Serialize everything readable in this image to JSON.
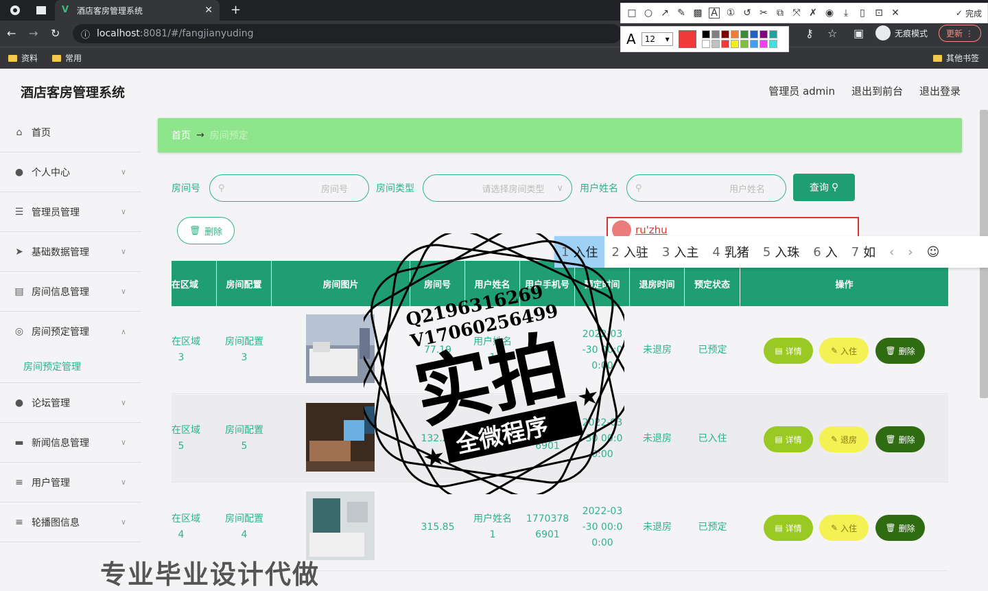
{
  "browser": {
    "tab_title": "酒店客房管理系统",
    "url_host": "localhost",
    "url_path": ":8081/#/fangjianyuding",
    "bookmarks": [
      "资料",
      "常用"
    ],
    "other_bookmarks": "其他书签",
    "incognito_label": "无痕模式",
    "update_label": "更新"
  },
  "annotation_toolbar": {
    "done_label": "完成",
    "font_size": "12",
    "active_color": "#f03a3a",
    "palette": [
      "#000000",
      "#808080",
      "#800000",
      "#f08030",
      "#3a8a3a",
      "#2060c0",
      "#800080",
      "#20a0a0",
      "#ffffff",
      "#c0c0c0",
      "#f03a3a",
      "#f0f020",
      "#80c040",
      "#40a0f0",
      "#f040f0",
      "#40e0e0"
    ]
  },
  "app": {
    "title": "酒店客房管理系统",
    "top_links": [
      "管理员 admin",
      "退出到前台",
      "退出登录"
    ]
  },
  "sidebar": {
    "items": [
      {
        "label": "首页",
        "icon": "home-icon"
      },
      {
        "label": "个人中心",
        "icon": "user-icon"
      },
      {
        "label": "管理员管理",
        "icon": "sliders-icon"
      },
      {
        "label": "基础数据管理",
        "icon": "send-icon"
      },
      {
        "label": "房间信息管理",
        "icon": "clipboard-icon"
      },
      {
        "label": "房间预定管理",
        "icon": "compass-icon"
      },
      {
        "label": "论坛管理",
        "icon": "user-icon"
      },
      {
        "label": "新闻信息管理",
        "icon": "monitor-icon"
      },
      {
        "label": "用户管理",
        "icon": "menu-icon"
      },
      {
        "label": "轮播图信息",
        "icon": "menu-icon"
      }
    ],
    "sub_item": "房间预定管理"
  },
  "breadcrumb": {
    "home": "首页",
    "arrow": "→",
    "current": "房间预定"
  },
  "search": {
    "room_no_label": "房间号",
    "room_no_placeholder": "房间号",
    "room_type_label": "房间类型",
    "room_type_placeholder": "请选择房间类型",
    "user_name_label": "用户姓名",
    "user_name_placeholder": "用户姓名",
    "query_label": "查询"
  },
  "delete_label": "删除",
  "ime": {
    "typed": "ru'zhu",
    "candidates": [
      {
        "n": "1",
        "text": "入住"
      },
      {
        "n": "2",
        "text": "入驻"
      },
      {
        "n": "3",
        "text": "入主"
      },
      {
        "n": "4",
        "text": "乳猪"
      },
      {
        "n": "5",
        "text": "入珠"
      },
      {
        "n": "6",
        "text": "入"
      },
      {
        "n": "7",
        "text": "如"
      }
    ]
  },
  "table": {
    "headers": [
      "所在区域",
      "房间配置",
      "房间图片",
      "房间号",
      "用户姓名",
      "用户手机号",
      "预定时间",
      "退房时间",
      "预定状态",
      "操作"
    ],
    "rows": [
      {
        "area": "所在区域\n3",
        "config": "房间配置\n3",
        "room_no": "77.19",
        "user": "用户姓名\n1",
        "phone": "",
        "time": "2022-03\n-30 00:0\n0:00",
        "checkout": "未退房",
        "status": "已预定",
        "action2": "入住"
      },
      {
        "area": "所在区域\n5",
        "config": "房间配置\n5",
        "room_no": "132.21",
        "user": "用户姓名\n1",
        "phone": "1770378\n6901",
        "time": "2022-03\n-30 00:0\n0:00",
        "checkout": "未退房",
        "status": "已入住",
        "action2": "退房"
      },
      {
        "area": "所在区域\n4",
        "config": "房间配置\n4",
        "room_no": "315.85",
        "user": "用户姓名\n1",
        "phone": "1770378\n6901",
        "time": "2022-03\n-30 00:0\n0:00",
        "checkout": "未退房",
        "status": "已预定",
        "action2": "入住"
      }
    ],
    "detail_label": "详情",
    "delete_label": "删除"
  },
  "watermark": {
    "contact_q": "Q2196316269",
    "contact_v": "V17060256499",
    "big_text": "实拍",
    "banner": "全微程序",
    "bottom": "专业毕业设计代做"
  }
}
